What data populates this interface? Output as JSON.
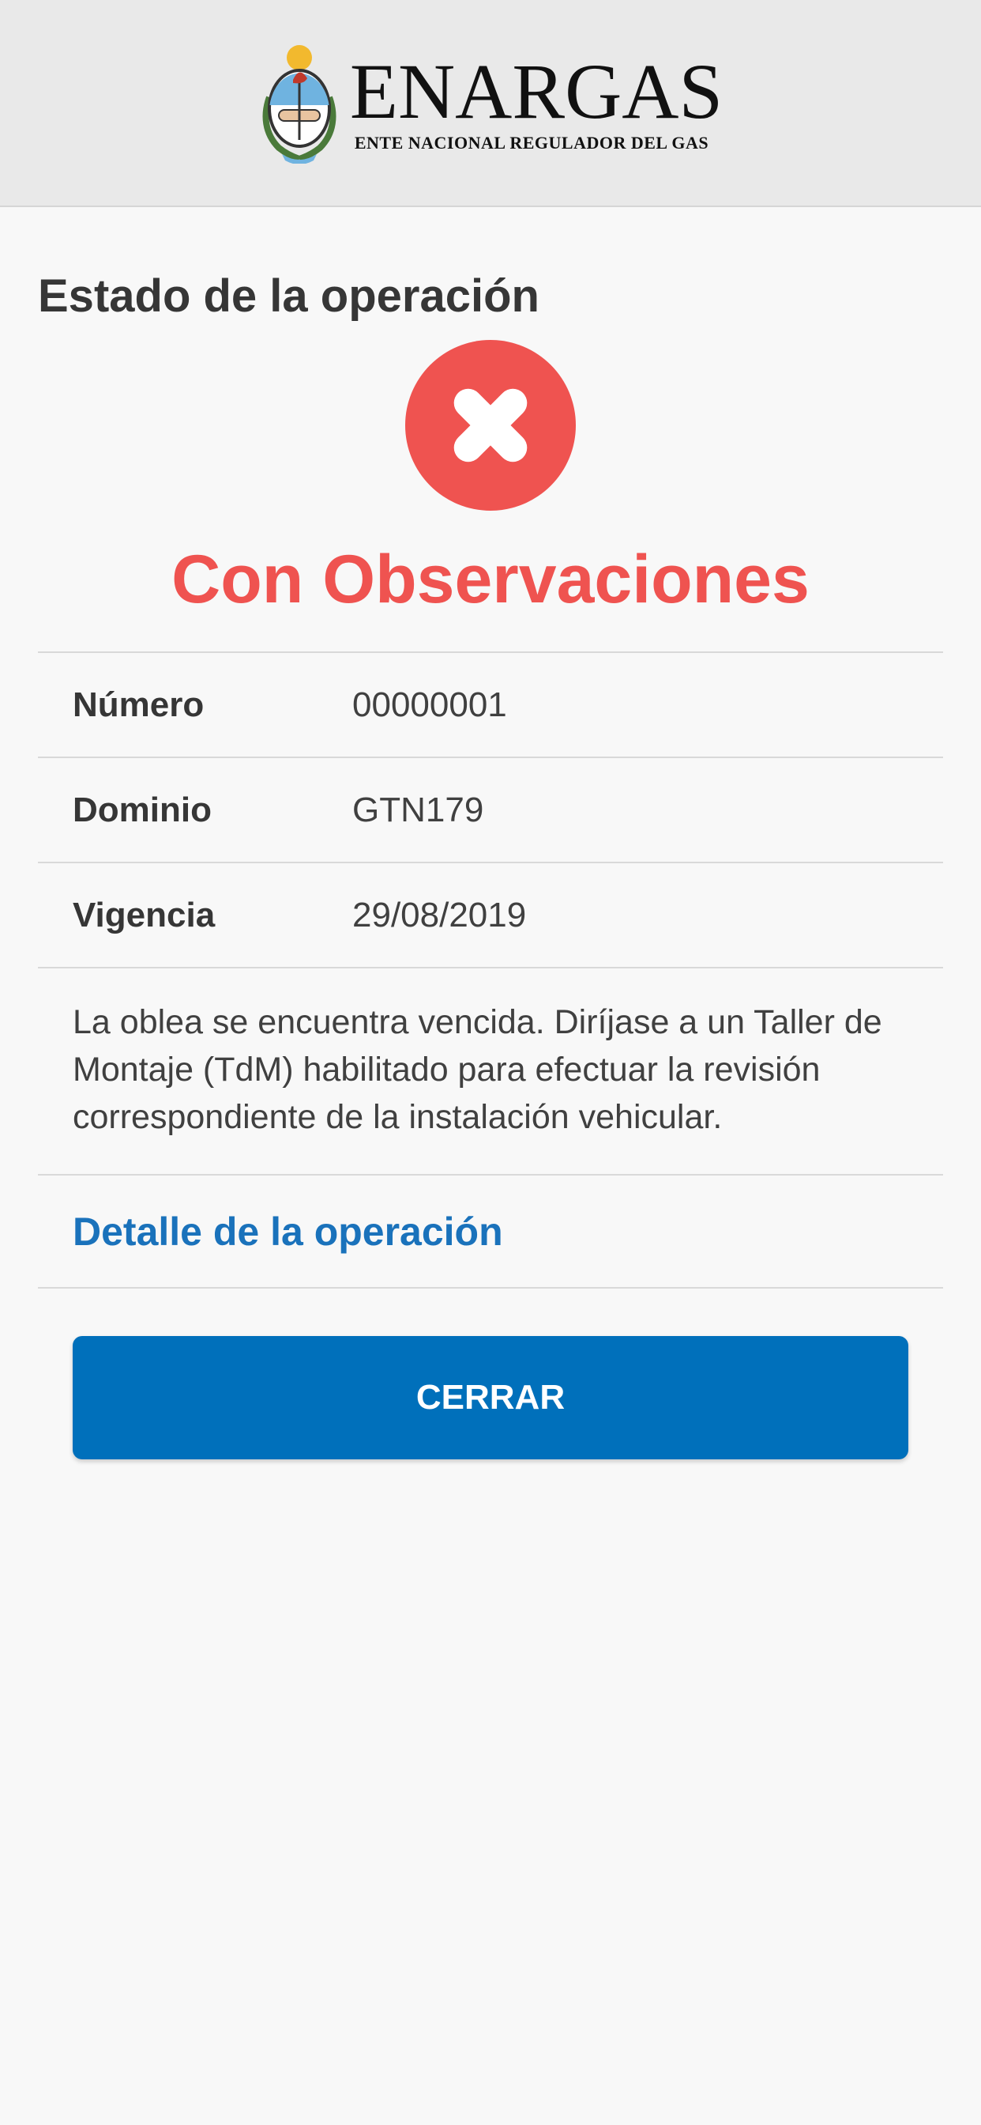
{
  "header": {
    "logo_icon": "argentina-coat-of-arms-icon",
    "brand_title": "ENARGAS",
    "brand_subtitle": "ENTE NACIONAL REGULADOR DEL GAS"
  },
  "main": {
    "section_title": "Estado de la operación",
    "status_icon": "error-x-icon",
    "status_text": "Con Observaciones",
    "rows": [
      {
        "label": "Número",
        "value": "00000001"
      },
      {
        "label": "Dominio",
        "value": "GTN179"
      },
      {
        "label": "Vigencia",
        "value": "29/08/2019"
      }
    ],
    "message": "La oblea se encuentra vencida. Diríjase a un Taller de Montaje (TdM) habilitado para efectuar la revisión correspondiente de la instalación vehicular.",
    "detail_link": "Detalle de la operación",
    "close_button": "CERRAR"
  },
  "colors": {
    "header_bg": "#e9e9e9",
    "page_bg": "#f8f8f8",
    "error_red": "#ef5350",
    "link_blue": "#1a72bb",
    "button_blue": "#0070bb"
  }
}
